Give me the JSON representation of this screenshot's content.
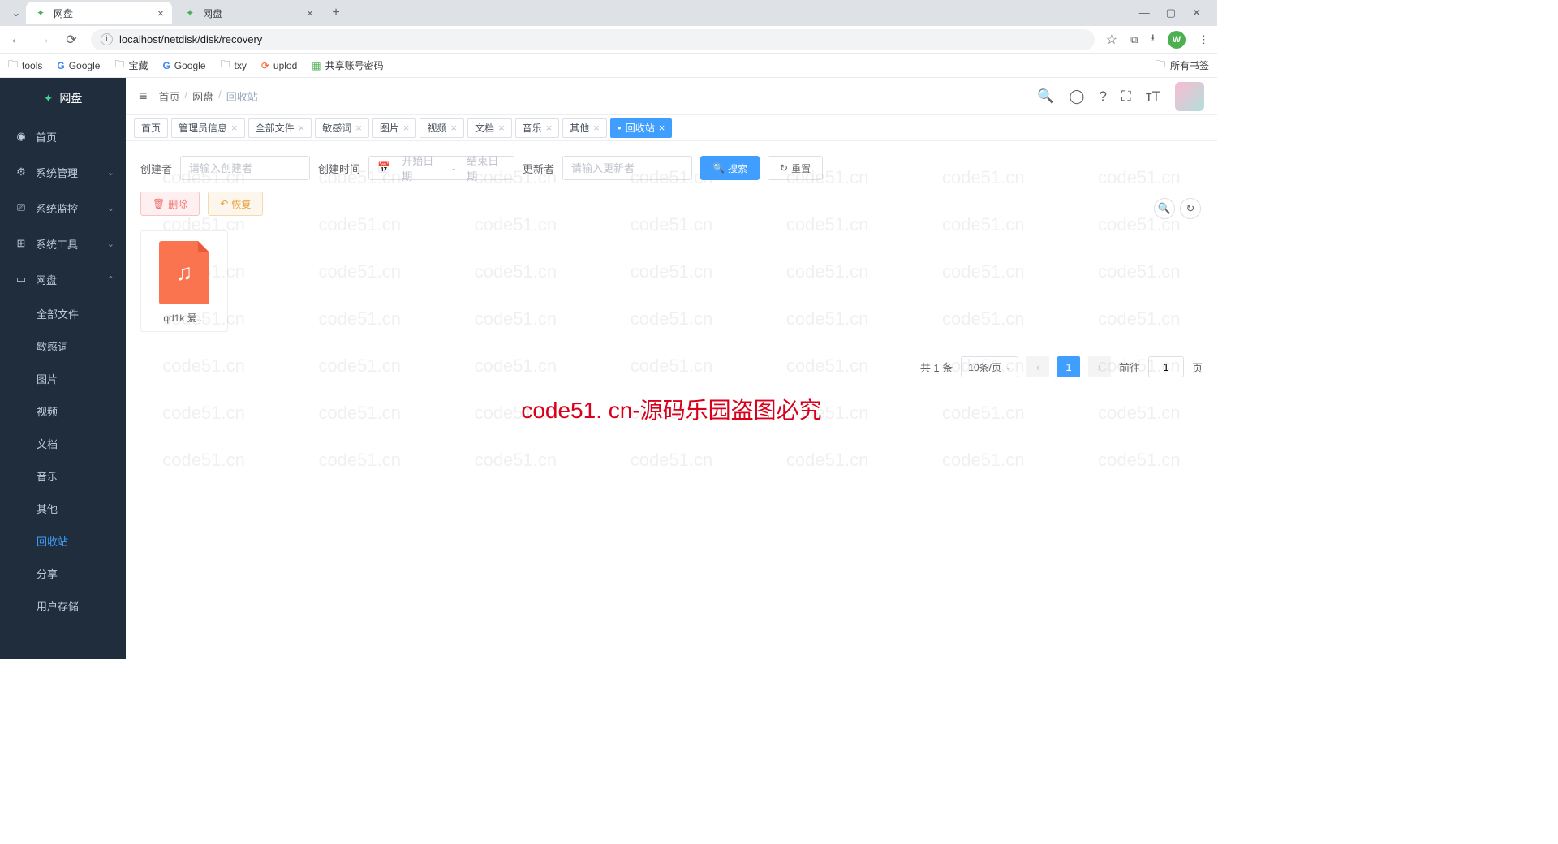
{
  "browser": {
    "tabs": [
      {
        "title": "网盘",
        "active": true
      },
      {
        "title": "网盘",
        "active": false
      }
    ],
    "url": "localhost/netdisk/disk/recovery",
    "avatar_letter": "W",
    "bookmarks": {
      "items": [
        "tools",
        "Google",
        "宝藏",
        "Google",
        "txy",
        "uplod",
        "共享账号密码"
      ],
      "right": "所有书签"
    }
  },
  "sidebar": {
    "logo": "网盘",
    "items": [
      {
        "icon": "dashboard",
        "label": "首页"
      },
      {
        "icon": "gear",
        "label": "系统管理",
        "children": true
      },
      {
        "icon": "monitor",
        "label": "系统监控",
        "children": true
      },
      {
        "icon": "tool",
        "label": "系统工具",
        "children": true
      },
      {
        "icon": "book",
        "label": "网盘",
        "children": true,
        "expanded": true
      }
    ],
    "subitems": [
      "全部文件",
      "敏感词",
      "图片",
      "视频",
      "文档",
      "音乐",
      "其他",
      "回收站",
      "分享",
      "用户存储"
    ],
    "active_sub": "回收站"
  },
  "header": {
    "breadcrumb": [
      "首页",
      "网盘",
      "回收站"
    ]
  },
  "tabs": [
    {
      "label": "首页",
      "closable": false
    },
    {
      "label": "管理员信息",
      "closable": true
    },
    {
      "label": "全部文件",
      "closable": true
    },
    {
      "label": "敏感词",
      "closable": true
    },
    {
      "label": "图片",
      "closable": true
    },
    {
      "label": "视频",
      "closable": true
    },
    {
      "label": "文档",
      "closable": true
    },
    {
      "label": "音乐",
      "closable": true
    },
    {
      "label": "其他",
      "closable": true
    },
    {
      "label": "回收站",
      "closable": true,
      "active": true
    }
  ],
  "search": {
    "creator_label": "创建者",
    "creator_placeholder": "请输入创建者",
    "create_time_label": "创建时间",
    "date_start": "开始日期",
    "date_sep": "-",
    "date_end": "结束日期",
    "updater_label": "更新者",
    "updater_placeholder": "请输入更新者",
    "search_btn": "搜索",
    "reset_btn": "重置"
  },
  "actions": {
    "delete": "删除",
    "restore": "恢复"
  },
  "files": [
    {
      "name": "qd1k 爱...",
      "type": "music"
    }
  ],
  "pagination": {
    "total_label": "共 1 条",
    "page_size": "10条/页",
    "current": "1",
    "goto_prefix": "前往",
    "goto_value": "1",
    "goto_suffix": "页"
  },
  "watermark": {
    "main": "code51. cn-源码乐园盗图必究",
    "bg": "code51.cn"
  }
}
